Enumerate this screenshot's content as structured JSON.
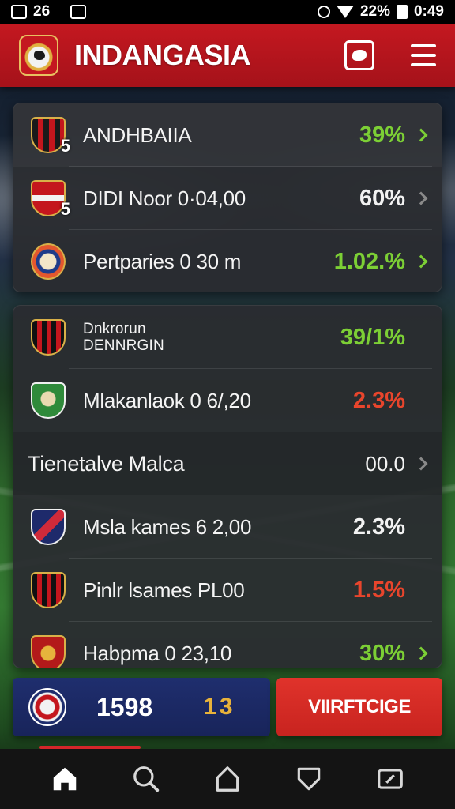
{
  "status_bar": {
    "time": "26",
    "battery": "22%",
    "extra": "0:49"
  },
  "header": {
    "title": "INDANGASIA"
  },
  "matches_top": [
    {
      "name": "ANDHBAIIA",
      "pct": "39%",
      "badge": "5",
      "color": "green",
      "chevron": "green",
      "crest": "red"
    },
    {
      "name": "DIDI Noor 0·04,00",
      "pct": "60%",
      "badge": "5",
      "color": "white",
      "chevron": "grey",
      "crest": "redwhite"
    },
    {
      "name": "Pertparies 0 30 m",
      "pct": "1.02.%",
      "badge": "",
      "color": "green",
      "chevron": "green",
      "crest": "round"
    }
  ],
  "matches_bottom": [
    {
      "name_line1": "Dnkrorun",
      "name_line2": "DENNRGIN",
      "pct": "39/1%",
      "color": "green",
      "crest": "blackred"
    },
    {
      "name": "Mlakanlaok 0 6/,20",
      "pct": "2.3%",
      "color": "red",
      "crest": "green"
    },
    {
      "section_title": "Tienetalve Malca",
      "value": "00.0"
    },
    {
      "name": "Msla kames 6 2,00",
      "pct": "2.3%",
      "color": "white",
      "crest": "navy"
    },
    {
      "name": "Pinlr lsames PL00",
      "pct": "1.5%",
      "color": "red",
      "crest": "blackred"
    },
    {
      "name": "Habpma 0 23,10",
      "pct": "30%",
      "color": "green",
      "crest": "redgold"
    }
  ],
  "score_bar": {
    "main": "1598",
    "side": "13",
    "cta": "VIIRFTCIGE"
  },
  "bottom_nav": [
    "home-icon",
    "search-icon",
    "house-outline-icon",
    "shield-icon",
    "tablet-icon"
  ],
  "colors": {
    "brand_red": "#c41820",
    "accent_green": "#7ccf35",
    "alert_red": "#e8452c",
    "navy": "#1f2e6e",
    "gold": "#e8b23a"
  }
}
